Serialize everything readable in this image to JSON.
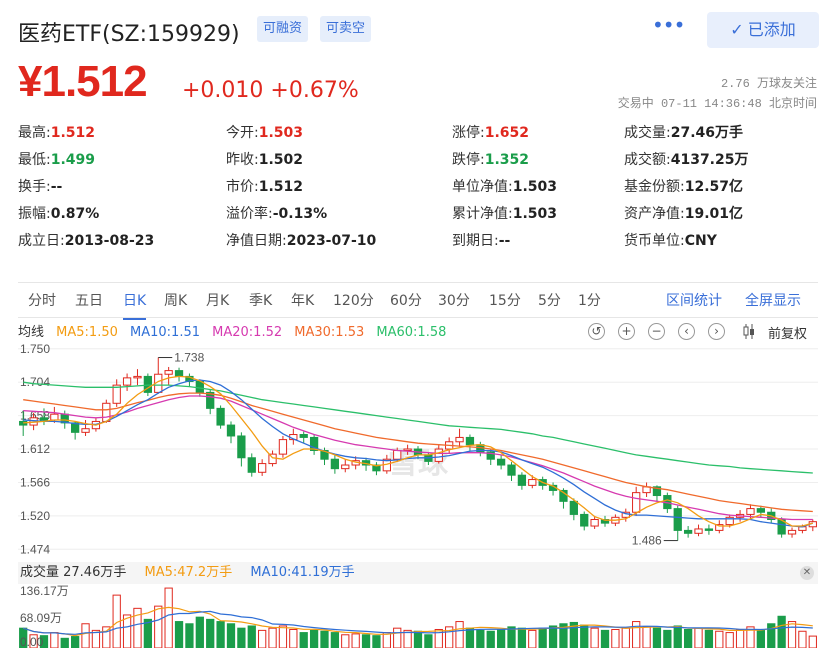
{
  "header": {
    "title": "医药ETF(SZ:159929)",
    "tags": [
      "可融资",
      "可卖空"
    ],
    "more_icon": "ellipsis-icon",
    "added_label": "已添加",
    "added_icon": "checkmark-icon"
  },
  "quote": {
    "price": "¥1.512",
    "change": "+0.010 +0.67%",
    "followers": "2.76 万球友关注",
    "trade_time": "交易中 07-11 14:36:48 北京时间",
    "color_up": "#e0281e",
    "color_down": "#1a9d4a"
  },
  "stats": [
    [
      {
        "label": "最高:",
        "value": "1.512",
        "tone": "up"
      },
      {
        "label": "今开:",
        "value": "1.503",
        "tone": "up"
      },
      {
        "label": "涨停:",
        "value": "1.652",
        "tone": "up"
      },
      {
        "label": "成交量:",
        "value": "27.46万手",
        "tone": ""
      }
    ],
    [
      {
        "label": "最低:",
        "value": "1.499",
        "tone": "down"
      },
      {
        "label": "昨收:",
        "value": "1.502",
        "tone": ""
      },
      {
        "label": "跌停:",
        "value": "1.352",
        "tone": "down"
      },
      {
        "label": "成交额:",
        "value": "4137.25万",
        "tone": ""
      }
    ],
    [
      {
        "label": "换手:",
        "value": "--",
        "tone": ""
      },
      {
        "label": "市价:",
        "value": "1.512",
        "tone": ""
      },
      {
        "label": "单位净值:",
        "value": "1.503",
        "tone": ""
      },
      {
        "label": "基金份额:",
        "value": "12.57亿",
        "tone": ""
      }
    ],
    [
      {
        "label": "振幅:",
        "value": "0.87%",
        "tone": ""
      },
      {
        "label": "溢价率:",
        "value": "-0.13%",
        "tone": ""
      },
      {
        "label": "累计净值:",
        "value": "1.503",
        "tone": ""
      },
      {
        "label": "资产净值:",
        "value": "19.01亿",
        "tone": ""
      }
    ],
    [
      {
        "label": "成立日:",
        "value": "2013-08-23",
        "tone": ""
      },
      {
        "label": "净值日期:",
        "value": "2023-07-10",
        "tone": ""
      },
      {
        "label": "到期日:",
        "value": "--",
        "tone": ""
      },
      {
        "label": "货币单位:",
        "value": "CNY",
        "tone": ""
      }
    ]
  ],
  "tabs": [
    "分时",
    "五日",
    "日K",
    "周K",
    "月K",
    "季K",
    "年K",
    "120分",
    "60分",
    "30分",
    "15分",
    "5分",
    "1分"
  ],
  "active_tab": 2,
  "links": {
    "interval_stats": "区间统计",
    "fullscreen": "全屏显示"
  },
  "ma_bar": {
    "label": "均线",
    "items": [
      {
        "text": "MA5:1.50",
        "color": "#f39c12"
      },
      {
        "text": "MA10:1.51",
        "color": "#2f6fd6"
      },
      {
        "text": "MA20:1.52",
        "color": "#d63ab0"
      },
      {
        "text": "MA30:1.53",
        "color": "#f06a2c"
      },
      {
        "text": "MA60:1.58",
        "color": "#2bbf6a"
      }
    ],
    "controls": [
      "reset-icon",
      "zoom-in-icon",
      "zoom-out-icon",
      "arrow-left-icon",
      "arrow-right-icon",
      "candle-icon"
    ],
    "adjust_label": "前复权"
  },
  "chart_data": {
    "type": "candlestick",
    "y_ticks": [
      "1.750",
      "1.704",
      "1.658",
      "1.612",
      "1.566",
      "1.520",
      "1.474"
    ],
    "ylim": [
      1.462,
      1.758
    ],
    "annotations": [
      {
        "text": "1.738",
        "candle": 13
      },
      {
        "text": "1.486",
        "candle": 63
      }
    ],
    "candles": [
      [
        1.65,
        1.645,
        1.665,
        1.63
      ],
      [
        1.645,
        1.655,
        1.662,
        1.638
      ],
      [
        1.655,
        1.652,
        1.668,
        1.645
      ],
      [
        1.652,
        1.66,
        1.67,
        1.648
      ],
      [
        1.66,
        1.648,
        1.665,
        1.64
      ],
      [
        1.648,
        1.635,
        1.65,
        1.625
      ],
      [
        1.635,
        1.64,
        1.652,
        1.63
      ],
      [
        1.64,
        1.65,
        1.655,
        1.636
      ],
      [
        1.65,
        1.675,
        1.68,
        1.648
      ],
      [
        1.675,
        1.7,
        1.708,
        1.67
      ],
      [
        1.7,
        1.71,
        1.716,
        1.692
      ],
      [
        1.71,
        1.712,
        1.722,
        1.7
      ],
      [
        1.712,
        1.69,
        1.716,
        1.685
      ],
      [
        1.69,
        1.715,
        1.738,
        1.688
      ],
      [
        1.715,
        1.72,
        1.725,
        1.7
      ],
      [
        1.72,
        1.712,
        1.724,
        1.705
      ],
      [
        1.712,
        1.705,
        1.716,
        1.698
      ],
      [
        1.705,
        1.69,
        1.708,
        1.684
      ],
      [
        1.69,
        1.668,
        1.694,
        1.66
      ],
      [
        1.668,
        1.645,
        1.672,
        1.64
      ],
      [
        1.645,
        1.63,
        1.65,
        1.62
      ],
      [
        1.63,
        1.6,
        1.635,
        1.588
      ],
      [
        1.6,
        1.58,
        1.606,
        1.574
      ],
      [
        1.58,
        1.592,
        1.598,
        1.575
      ],
      [
        1.592,
        1.605,
        1.61,
        1.588
      ],
      [
        1.605,
        1.625,
        1.63,
        1.6
      ],
      [
        1.625,
        1.632,
        1.64,
        1.618
      ],
      [
        1.632,
        1.628,
        1.636,
        1.62
      ],
      [
        1.628,
        1.61,
        1.632,
        1.604
      ],
      [
        1.61,
        1.598,
        1.614,
        1.59
      ],
      [
        1.598,
        1.585,
        1.604,
        1.578
      ],
      [
        1.585,
        1.59,
        1.598,
        1.58
      ],
      [
        1.59,
        1.596,
        1.602,
        1.584
      ],
      [
        1.596,
        1.59,
        1.6,
        1.582
      ],
      [
        1.59,
        1.582,
        1.594,
        1.576
      ],
      [
        1.582,
        1.598,
        1.604,
        1.578
      ],
      [
        1.598,
        1.61,
        1.614,
        1.594
      ],
      [
        1.61,
        1.612,
        1.618,
        1.604
      ],
      [
        1.612,
        1.604,
        1.616,
        1.598
      ],
      [
        1.604,
        1.595,
        1.608,
        1.59
      ],
      [
        1.595,
        1.612,
        1.618,
        1.592
      ],
      [
        1.612,
        1.622,
        1.628,
        1.606
      ],
      [
        1.622,
        1.628,
        1.64,
        1.615
      ],
      [
        1.628,
        1.618,
        1.632,
        1.61
      ],
      [
        1.618,
        1.608,
        1.622,
        1.602
      ],
      [
        1.608,
        1.598,
        1.612,
        1.59
      ],
      [
        1.598,
        1.59,
        1.604,
        1.584
      ],
      [
        1.59,
        1.576,
        1.594,
        1.568
      ],
      [
        1.576,
        1.562,
        1.58,
        1.556
      ],
      [
        1.562,
        1.57,
        1.576,
        1.558
      ],
      [
        1.57,
        1.562,
        1.574,
        1.556
      ],
      [
        1.562,
        1.555,
        1.566,
        1.548
      ],
      [
        1.555,
        1.54,
        1.558,
        1.53
      ],
      [
        1.54,
        1.522,
        1.544,
        1.514
      ],
      [
        1.522,
        1.506,
        1.526,
        1.5
      ],
      [
        1.506,
        1.515,
        1.52,
        1.502
      ],
      [
        1.515,
        1.51,
        1.52,
        1.505
      ],
      [
        1.51,
        1.518,
        1.522,
        1.506
      ],
      [
        1.518,
        1.525,
        1.53,
        1.512
      ],
      [
        1.525,
        1.552,
        1.56,
        1.52
      ],
      [
        1.552,
        1.56,
        1.566,
        1.546
      ],
      [
        1.56,
        1.548,
        1.562,
        1.54
      ],
      [
        1.548,
        1.53,
        1.552,
        1.524
      ],
      [
        1.53,
        1.5,
        1.534,
        1.486
      ],
      [
        1.5,
        1.496,
        1.506,
        1.49
      ],
      [
        1.496,
        1.502,
        1.508,
        1.492
      ],
      [
        1.502,
        1.5,
        1.508,
        1.494
      ],
      [
        1.5,
        1.508,
        1.514,
        1.496
      ],
      [
        1.508,
        1.518,
        1.522,
        1.504
      ],
      [
        1.518,
        1.522,
        1.528,
        1.512
      ],
      [
        1.522,
        1.53,
        1.536,
        1.516
      ],
      [
        1.53,
        1.525,
        1.534,
        1.518
      ],
      [
        1.525,
        1.515,
        1.53,
        1.51
      ],
      [
        1.515,
        1.495,
        1.518,
        1.49
      ],
      [
        1.495,
        1.5,
        1.504,
        1.49
      ],
      [
        1.5,
        1.505,
        1.508,
        1.496
      ],
      [
        1.505,
        1.512,
        1.515,
        1.499
      ]
    ],
    "ma_series": [
      {
        "name": "MA60",
        "color": "#2bbf6a",
        "values": [
          1.704,
          1.702,
          1.701,
          1.7,
          1.699,
          1.698,
          1.697,
          1.697,
          1.697,
          1.697,
          1.698,
          1.699,
          1.7,
          1.7,
          1.7,
          1.699,
          1.698,
          1.696,
          1.694,
          1.692,
          1.689,
          1.686,
          1.683,
          1.68,
          1.678,
          1.676,
          1.674,
          1.672,
          1.67,
          1.668,
          1.666,
          1.664,
          1.662,
          1.66,
          1.658,
          1.656,
          1.654,
          1.652,
          1.65,
          1.648,
          1.646,
          1.644,
          1.643,
          1.642,
          1.641,
          1.64,
          1.639,
          1.637,
          1.635,
          1.633,
          1.63,
          1.628,
          1.625,
          1.622,
          1.619,
          1.616,
          1.613,
          1.61,
          1.607,
          1.604,
          1.602,
          1.6,
          1.598,
          1.596,
          1.594,
          1.592,
          1.59,
          1.589,
          1.588,
          1.586,
          1.585,
          1.584,
          1.583,
          1.582,
          1.581,
          1.58,
          1.579
        ]
      },
      {
        "name": "MA30",
        "color": "#f06a2c",
        "values": [
          1.68,
          1.678,
          1.676,
          1.674,
          1.672,
          1.67,
          1.668,
          1.666,
          1.666,
          1.668,
          1.672,
          1.676,
          1.679,
          1.683,
          1.686,
          1.688,
          1.689,
          1.689,
          1.688,
          1.686,
          1.682,
          1.677,
          1.672,
          1.668,
          1.664,
          1.66,
          1.656,
          1.652,
          1.648,
          1.644,
          1.64,
          1.637,
          1.634,
          1.631,
          1.628,
          1.626,
          1.624,
          1.622,
          1.62,
          1.619,
          1.618,
          1.617,
          1.616,
          1.615,
          1.614,
          1.612,
          1.61,
          1.607,
          1.604,
          1.601,
          1.598,
          1.594,
          1.59,
          1.586,
          1.582,
          1.578,
          1.574,
          1.57,
          1.566,
          1.563,
          1.56,
          1.558,
          1.556,
          1.553,
          1.55,
          1.547,
          1.544,
          1.541,
          1.539,
          1.537,
          1.535,
          1.533,
          1.531,
          1.529,
          1.528,
          1.527,
          1.526
        ]
      },
      {
        "name": "MA20",
        "color": "#d63ab0",
        "values": [
          1.665,
          1.664,
          1.663,
          1.662,
          1.66,
          1.658,
          1.656,
          1.655,
          1.656,
          1.659,
          1.663,
          1.668,
          1.672,
          1.676,
          1.68,
          1.683,
          1.685,
          1.685,
          1.684,
          1.682,
          1.678,
          1.672,
          1.666,
          1.66,
          1.654,
          1.648,
          1.642,
          1.637,
          1.632,
          1.628,
          1.624,
          1.621,
          1.618,
          1.616,
          1.614,
          1.612,
          1.61,
          1.609,
          1.608,
          1.607,
          1.606,
          1.606,
          1.607,
          1.607,
          1.607,
          1.606,
          1.604,
          1.601,
          1.597,
          1.593,
          1.589,
          1.584,
          1.579,
          1.573,
          1.567,
          1.561,
          1.556,
          1.551,
          1.547,
          1.544,
          1.542,
          1.54,
          1.538,
          1.535,
          1.532,
          1.529,
          1.526,
          1.523,
          1.521,
          1.52,
          1.519,
          1.518,
          1.517,
          1.516,
          1.515,
          1.515,
          1.515
        ]
      },
      {
        "name": "MA10",
        "color": "#2f6fd6",
        "values": [
          1.652,
          1.651,
          1.65,
          1.65,
          1.649,
          1.647,
          1.646,
          1.646,
          1.65,
          1.657,
          1.665,
          1.673,
          1.68,
          1.689,
          1.697,
          1.702,
          1.706,
          1.707,
          1.705,
          1.7,
          1.691,
          1.68,
          1.667,
          1.654,
          1.643,
          1.633,
          1.626,
          1.62,
          1.614,
          1.609,
          1.605,
          1.602,
          1.6,
          1.599,
          1.597,
          1.596,
          1.597,
          1.599,
          1.6,
          1.6,
          1.601,
          1.603,
          1.606,
          1.609,
          1.61,
          1.61,
          1.608,
          1.603,
          1.597,
          1.592,
          1.587,
          1.58,
          1.572,
          1.563,
          1.553,
          1.544,
          1.535,
          1.528,
          1.523,
          1.521,
          1.521,
          1.52,
          1.519,
          1.518,
          1.517,
          1.516,
          1.516,
          1.516,
          1.516,
          1.516,
          1.515,
          1.512,
          1.51,
          1.508,
          1.506,
          1.505,
          1.51
        ]
      },
      {
        "name": "MA5",
        "color": "#f39c12",
        "values": [
          1.648,
          1.649,
          1.65,
          1.652,
          1.652,
          1.65,
          1.647,
          1.645,
          1.65,
          1.66,
          1.675,
          1.687,
          1.696,
          1.705,
          1.71,
          1.712,
          1.711,
          1.706,
          1.698,
          1.688,
          1.672,
          1.654,
          1.636,
          1.616,
          1.6,
          1.598,
          1.606,
          1.612,
          1.612,
          1.609,
          1.604,
          1.598,
          1.594,
          1.592,
          1.589,
          1.591,
          1.595,
          1.6,
          1.604,
          1.604,
          1.607,
          1.611,
          1.614,
          1.617,
          1.618,
          1.615,
          1.607,
          1.596,
          1.585,
          1.574,
          1.566,
          1.561,
          1.552,
          1.542,
          1.531,
          1.519,
          1.514,
          1.514,
          1.516,
          1.524,
          1.532,
          1.538,
          1.542,
          1.538,
          1.53,
          1.52,
          1.512,
          1.506,
          1.506,
          1.51,
          1.516,
          1.522,
          1.52,
          1.514,
          1.506,
          1.506,
          1.51
        ]
      }
    ]
  },
  "volume": {
    "label": "成交量 27.46万手",
    "ma5_label": "MA5:47.2万手",
    "ma10_label": "MA10:41.19万手",
    "ma5_color": "#f39c12",
    "ma10_color": "#2f6fd6",
    "y_ticks": [
      "136.17万",
      "68.09万",
      "0.00"
    ],
    "ymax": 136.17,
    "values": [
      45,
      30,
      28,
      35,
      22,
      26,
      55,
      40,
      48,
      120,
      75,
      90,
      65,
      95,
      136,
      60,
      55,
      70,
      65,
      60,
      55,
      45,
      50,
      40,
      45,
      50,
      42,
      35,
      40,
      38,
      35,
      30,
      32,
      30,
      28,
      35,
      45,
      40,
      38,
      30,
      42,
      48,
      60,
      45,
      40,
      38,
      42,
      48,
      45,
      40,
      45,
      50,
      55,
      58,
      52,
      45,
      40,
      42,
      45,
      60,
      48,
      45,
      40,
      50,
      42,
      45,
      40,
      38,
      35,
      42,
      48,
      40,
      55,
      72,
      60,
      38,
      27
    ]
  }
}
